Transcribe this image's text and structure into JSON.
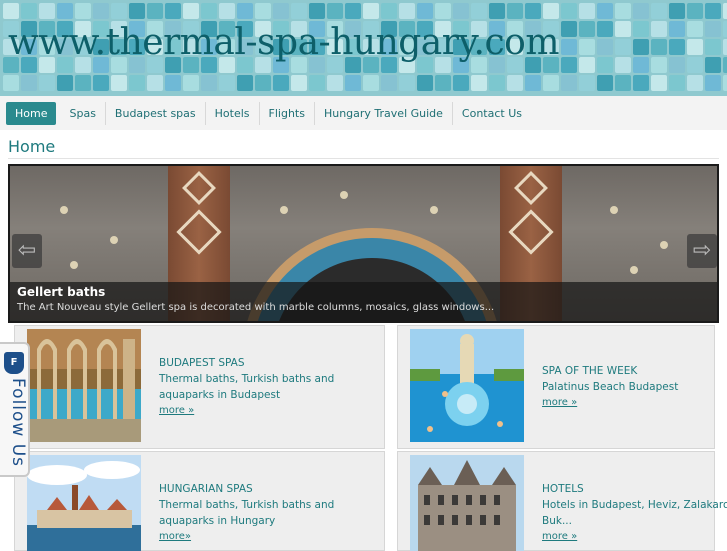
{
  "site": {
    "title": "www.thermal-spa-hungary.com"
  },
  "nav": {
    "items": [
      {
        "label": "Home",
        "active": true
      },
      {
        "label": "Spas"
      },
      {
        "label": "Budapest spas"
      },
      {
        "label": "Hotels"
      },
      {
        "label": "Flights"
      },
      {
        "label": "Hungary Travel Guide"
      },
      {
        "label": "Contact Us"
      }
    ]
  },
  "page": {
    "title": "Home"
  },
  "slider": {
    "caption_title": "Gellert baths",
    "caption_text": "The Art Nouveau style Gellert spa is decorated with marble columns, mosaics, glass windows...",
    "prev_icon": "arrow-left-icon",
    "next_icon": "arrow-right-icon"
  },
  "boxes": [
    {
      "title": "BUDAPEST SPAS",
      "text": "Thermal baths, Turkish baths and aquaparks in Budapest",
      "more": "more »"
    },
    {
      "title": "SPA OF THE WEEK",
      "text": "Palatinus Beach Budapest",
      "more": "more »"
    },
    {
      "title": "HUNGARIAN SPAS",
      "text": "Thermal baths, Turkish baths and aquaparks in Hungary",
      "more": "more»"
    },
    {
      "title": "HOTELS",
      "text": "Hotels in Budapest, Heviz, Zalakaros, Buk...",
      "more": "more »"
    }
  ],
  "follow": {
    "label": "Follow Us",
    "icon": "shield-f-icon",
    "badge": "F"
  },
  "colors": {
    "accent": "#2a8a8e",
    "link": "#1e7a7e",
    "title": "#0d5f69"
  }
}
